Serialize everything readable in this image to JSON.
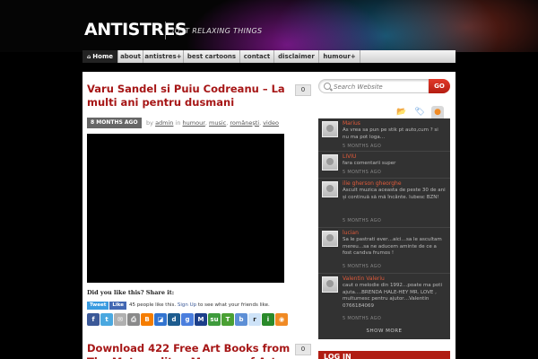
{
  "site": {
    "title": "ANTISTRES",
    "tagline": "JUST RELAXING THINGS"
  },
  "nav": {
    "items": [
      {
        "label": "Home"
      },
      {
        "label": "about"
      },
      {
        "label": "antistres+"
      },
      {
        "label": "best cartoons"
      },
      {
        "label": "contact"
      },
      {
        "label": "disclaimer"
      },
      {
        "label": "humour+"
      }
    ]
  },
  "post1": {
    "title": "Varu Sandel si Puiu Codreanu – La multi ani pentru dusmani",
    "comment_count": "0",
    "date_badge": "8 MONTHS AGO",
    "by_label": "by",
    "author": "admin",
    "in_label": "in",
    "categories": [
      "humour",
      "music",
      "românești",
      "video"
    ],
    "share_label": "Did you like this? Share it:",
    "tweet_label": "Tweet",
    "like_label": "Like",
    "like_text": "45 people like this.",
    "signup_link": "Sign Up",
    "signup_text": "to see what your friends like."
  },
  "share_icons": [
    {
      "name": "facebook-icon",
      "glyph": "f",
      "color": "#3b5998"
    },
    {
      "name": "twitter-icon",
      "glyph": "t",
      "color": "#4aa8e0"
    },
    {
      "name": "email-icon",
      "glyph": "✉",
      "color": "#b0b0b0"
    },
    {
      "name": "print-icon",
      "glyph": "⎙",
      "color": "#8a8a8a"
    },
    {
      "name": "blogger-icon",
      "glyph": "B",
      "color": "#f57d00"
    },
    {
      "name": "delicious-icon",
      "glyph": "◪",
      "color": "#3274d0"
    },
    {
      "name": "digg-icon",
      "glyph": "d",
      "color": "#1d5c8f"
    },
    {
      "name": "google-icon",
      "glyph": "g",
      "color": "#4a7ede"
    },
    {
      "name": "myspace-icon",
      "glyph": "M",
      "color": "#1c3f8a"
    },
    {
      "name": "stumbleupon-icon",
      "glyph": "su",
      "color": "#3e9b3c"
    },
    {
      "name": "technorati-icon",
      "glyph": "T",
      "color": "#4aa033"
    },
    {
      "name": "buzz-icon",
      "glyph": "b",
      "color": "#5d8fd6"
    },
    {
      "name": "reddit-icon",
      "glyph": "r",
      "color": "#cee3f8"
    },
    {
      "name": "identica-icon",
      "glyph": "i",
      "color": "#2a8a2a"
    },
    {
      "name": "rss-icon",
      "glyph": "◉",
      "color": "#f08a24"
    }
  ],
  "post2": {
    "title": "Download 422 Free Art Books from The Metropolitan Museum of Art",
    "comment_count": "0"
  },
  "search": {
    "placeholder": "Search Website",
    "button_label": "GO"
  },
  "sidebar_tabs": [
    {
      "name": "categories-tab-icon",
      "glyph": "📂"
    },
    {
      "name": "tags-tab-icon",
      "glyph": "🏷"
    },
    {
      "name": "comments-tab-icon",
      "glyph": "●"
    }
  ],
  "comments": [
    {
      "author": "Marius",
      "text": "As vrea sa pun pe stik pt auto,cum ? si nu ma pot loga…",
      "time": "5 MONTHS AGO"
    },
    {
      "author": "LIVIU",
      "text": "fara comentarii super",
      "time": "5 MONTHS AGO"
    },
    {
      "author": "ilie gherson gheorghe",
      "text": "Ascult muzica aceasta de peste 30 de ani și continuă să mă încânte. lubesc BZN!",
      "time": "5 MONTHS AGO"
    },
    {
      "author": "lucian",
      "text": "Sa le pastrati ever…aici…sa le ascultam mereu…sa ne aducem aminte de ce a fost candva frumos !",
      "time": "5 MONTHS AGO"
    },
    {
      "author": "Valentin Valeriu",
      "text": "caut o melodie din 1992…poate ma poti ajuta….BRENDA HALE-HEY MR. LOVE , multumesc pentru ajutor…Valentin 0766184069",
      "time": "5 MONTHS AGO"
    }
  ],
  "show_more": "SHOW MORE",
  "login_title": "LOG IN"
}
